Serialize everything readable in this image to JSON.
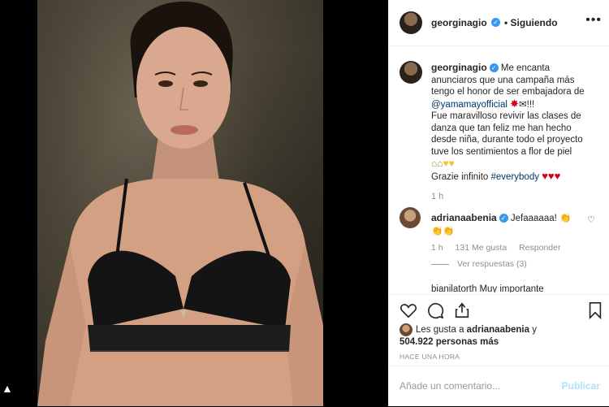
{
  "post": {
    "username": "georginagio",
    "follow_status": "Siguiendo",
    "caption_user": "georginagio",
    "caption_line1": "Me encanta anunciaros que una campaña más tengo el honor de ser embajadora de",
    "caption_mention": "@yamamayofficial",
    "caption_line2": "Fue maravilloso revivir las clases de danza que tan feliz me han hecho desde niña, durante todo el proyecto tuve los sentimientos a flor de piel",
    "caption_line3a": "Grazie infinito",
    "caption_hashtag": "#everybody",
    "caption_time": "1 h"
  },
  "comment": {
    "username": "adrianaabenia",
    "text": "Jefaaaaaa!",
    "time": "1 h",
    "likes": "131 Me gusta",
    "reply": "Responder",
    "view_replies": "Ver respuestas (3)",
    "next_partial": "bianilatorth  Muy importante"
  },
  "likes_text_prefix": "Les gusta a",
  "likes_user": "adrianaabenia",
  "likes_text_mid": "y",
  "likes_count": "504.922 personas más",
  "time_ago": "HACE UNA HORA",
  "comment_placeholder": "Añade un comentario...",
  "publish_label": "Publicar",
  "icons": [
    "heart-icon",
    "comment-icon",
    "share-icon",
    "bookmark-icon",
    "more-icon",
    "verified-icon"
  ]
}
